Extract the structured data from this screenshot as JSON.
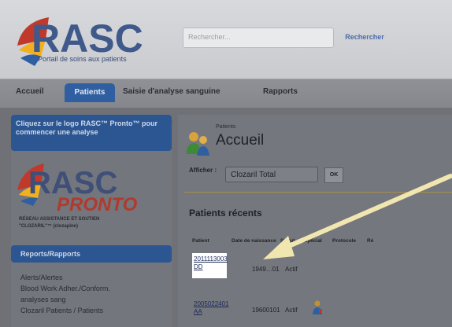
{
  "header": {
    "logo_text": "RASC",
    "logo_tagline": "Portail de soins aux patients",
    "search_placeholder": "Rechercher...",
    "search_button": "Rechercher"
  },
  "nav": {
    "items": [
      {
        "label": "Accueil"
      },
      {
        "label": "Patients"
      },
      {
        "label": "Saisie d'analyse sanguine"
      },
      {
        "label": "Rapports"
      }
    ],
    "active": "Patients"
  },
  "sidebar": {
    "promo_text": "Cliquez sur le logo RASC™ Pronto™ pour commencer une analyse",
    "pronto_logo": {
      "name": "RASC PRONTO",
      "tagline_1": "RÉSEAU ASSISTANCE ET SOUTIEN",
      "tagline_2": "\"CLOZARIL\"™ (clozapine)"
    },
    "reports_heading": "Reports/Rapports",
    "links": [
      "Alerts/Alertes",
      "Blood Work Adher./Conform.",
      "analyses sang",
      "Clozaril Patients / Patients"
    ]
  },
  "main": {
    "breadcrumb": "Patients",
    "title": "Accueil",
    "show_label": "Afficher :",
    "show_value": "Clozaril Total",
    "ok_button": "OK",
    "recent_title": "Patients récents",
    "columns": [
      "Patient",
      "Date de naissance",
      "Statut",
      "Spécial",
      "Protocole",
      "Ré"
    ],
    "rows": [
      {
        "patient_id": "2011113003 DD",
        "dob": "1949…01",
        "status": "Actif",
        "special": false
      },
      {
        "patient_id": "2005022401 AA",
        "dob": "19600101",
        "status": "Actif",
        "special": true
      }
    ]
  },
  "annotation": {
    "arrow_color": "#f2e6b0"
  },
  "colors": {
    "accent_blue": "#2f5fa0",
    "logo_red": "#c0392b",
    "overlay_gray": "#6f7176"
  }
}
